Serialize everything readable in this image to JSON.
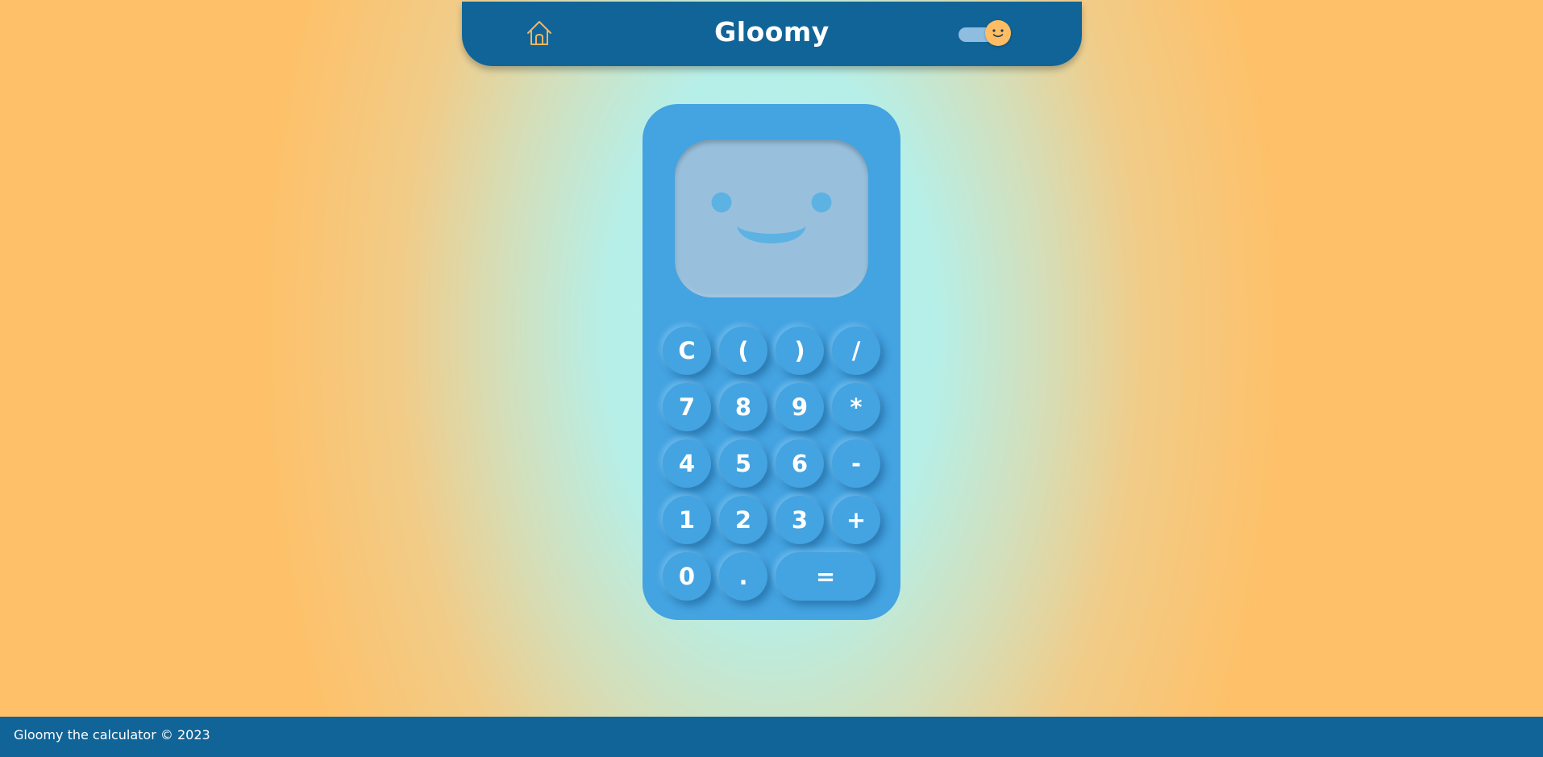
{
  "header": {
    "title": "Gloomy",
    "home_icon": "home-icon",
    "theme_toggle_icon": "smiley-sun-icon"
  },
  "calculator": {
    "display_face": "smiley-face",
    "buttons": {
      "clear": "C",
      "open_paren": "(",
      "close_paren": ")",
      "divide": "/",
      "seven": "7",
      "eight": "8",
      "nine": "9",
      "multiply": "*",
      "four": "4",
      "five": "5",
      "six": "6",
      "subtract": "-",
      "one": "1",
      "two": "2",
      "three": "3",
      "add": "+",
      "zero": "0",
      "decimal": ".",
      "equals": "="
    }
  },
  "footer": {
    "text": "Gloomy the calculator © 2023"
  },
  "colors": {
    "header_bg": "#116497",
    "calculator_bg": "#44a3e1",
    "screen_bg": "#98c0dd",
    "accent_orange": "#ffbd63",
    "page_center": "#b4f1ee",
    "page_edge": "#fec068"
  }
}
